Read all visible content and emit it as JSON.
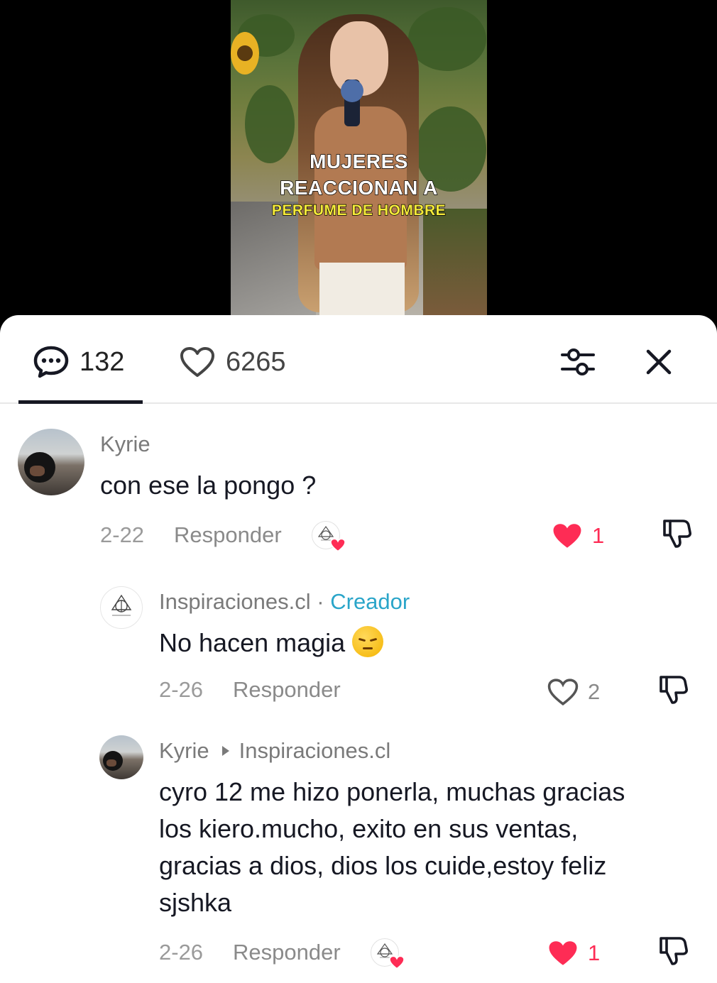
{
  "video": {
    "overlay_line1": "MUJERES",
    "overlay_line2": "REACCIONAN A",
    "overlay_line3": "PERFUME DE HOMBRE"
  },
  "header": {
    "comments_count": "132",
    "likes_count": "6265",
    "comments_icon": "comment-bubble-icon",
    "likes_icon": "heart-outline-icon",
    "filter_icon": "sliders-icon",
    "close_icon": "close-icon"
  },
  "comments": [
    {
      "username": "Kyrie",
      "text": "con ese la pongo ?",
      "date": "2-22",
      "reply_label": "Responder",
      "like_count": "1",
      "liked": true,
      "liked_by_creator": true
    },
    {
      "username": "Inspiraciones.cl",
      "separator": "·",
      "creator_label": "Creador",
      "text": "No hacen magia",
      "emoji": "pensive-face",
      "date": "2-26",
      "reply_label": "Responder",
      "like_count": "2",
      "liked": false
    },
    {
      "username": "Kyrie",
      "reply_to": "Inspiraciones.cl",
      "text_lines": [
        "cyro 12 me hizo ponerla, muchas gracias",
        "los kiero.mucho, exito en sus ventas,",
        "gracias a dios, dios los cuide,estoy feliz",
        "sjshka"
      ],
      "date": "2-26",
      "reply_label": "Responder",
      "like_count": "1",
      "liked": true,
      "liked_by_creator": true
    }
  ],
  "colors": {
    "like_red": "#fe2c55",
    "creator_blue": "#2aa5c9",
    "text_dark": "#161823",
    "text_gray": "#8a8a8a"
  }
}
